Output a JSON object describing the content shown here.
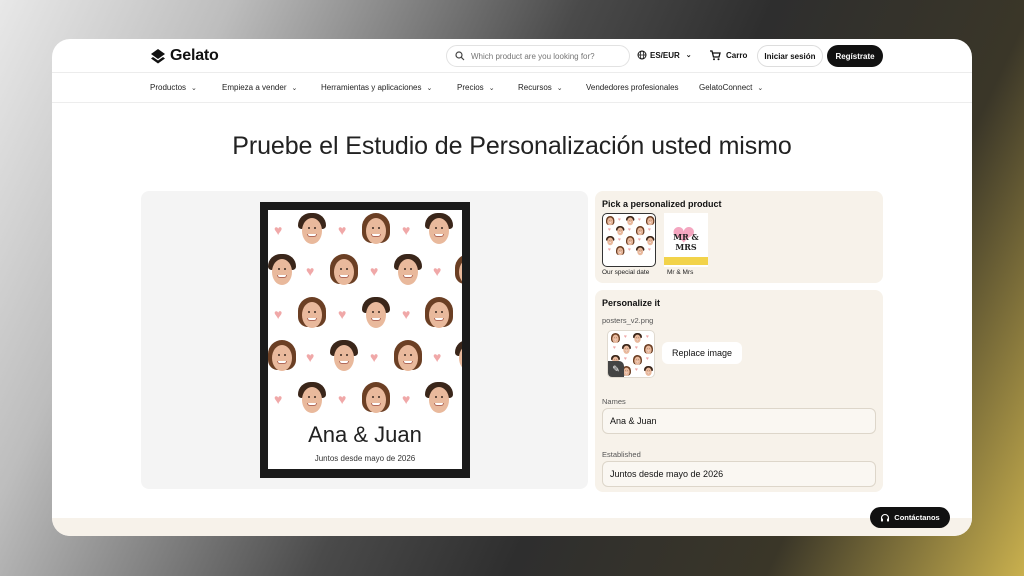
{
  "header": {
    "logo_text": "Gelato",
    "search_placeholder": "Which product are you looking for?",
    "language": "ES/EUR",
    "cart_label": "Carro",
    "login_label": "Iniciar sesión",
    "register_label": "Regístrate"
  },
  "nav": {
    "items": [
      {
        "label": "Productos"
      },
      {
        "label": "Empieza a vender"
      },
      {
        "label": "Herramientas y aplicaciones"
      },
      {
        "label": "Precios"
      },
      {
        "label": "Recursos"
      },
      {
        "label": "Vendedores profesionales"
      },
      {
        "label": "GelatoConnect"
      }
    ]
  },
  "main": {
    "title": "Pruebe el Estudio de Personalización usted mismo",
    "poster": {
      "names": "Ana & Juan",
      "subtitle": "Juntos desde mayo de 2026"
    }
  },
  "pick": {
    "title": "Pick a personalized product",
    "products": [
      {
        "label": "Our special date",
        "selected": true
      },
      {
        "label": "Mr & Mrs",
        "selected": false
      }
    ],
    "mrmrs_text": "MR & MRS"
  },
  "personalize": {
    "title": "Personalize it",
    "file_name": "posters_v2.png",
    "replace_label": "Replace image",
    "names_label": "Names",
    "names_value": "Ana & Juan",
    "established_label": "Established",
    "established_value": "Juntos desde mayo de 2026"
  },
  "contact": {
    "label": "Contáctanos"
  },
  "colors": {
    "accent": "#111111",
    "panel_bg": "#f7f2ea",
    "heart": "#f0a8a8"
  }
}
